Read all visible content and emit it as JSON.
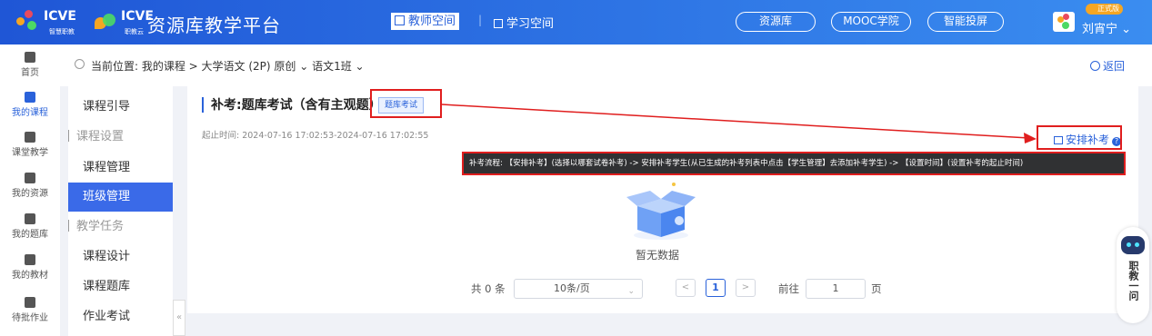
{
  "header": {
    "brand1": "ICVE",
    "brand1_sub": "智慧职教",
    "brand2": "ICVE",
    "brand2_sub": "职教云",
    "platform": "资源库教学平台",
    "space_teacher": "教师空间",
    "separator": "|",
    "space_learn": "学习空间",
    "pills": [
      "资源库",
      "MOOC学院",
      "智能投屏"
    ],
    "badge": "正式版",
    "user": "刘宵宁 ⌄"
  },
  "left_nav": [
    {
      "label": "首页",
      "icon": "home-icon"
    },
    {
      "label": "我的课程",
      "icon": "book-icon",
      "active": true
    },
    {
      "label": "课堂教学",
      "icon": "play-icon"
    },
    {
      "label": "我的资源",
      "icon": "library-icon"
    },
    {
      "label": "我的题库",
      "icon": "question-bank-icon"
    },
    {
      "label": "我的教材",
      "icon": "textbook-icon"
    },
    {
      "label": "待批作业",
      "icon": "homework-icon"
    }
  ],
  "breadcrumb": {
    "text": "当前位置: 我的课程 > 大学语文 (2P) 原创 ⌄  语文1班 ⌄",
    "back": "返回"
  },
  "side_menu": [
    {
      "label": "课程引导",
      "type": "item"
    },
    {
      "label": "课程设置",
      "type": "group"
    },
    {
      "label": "课程管理",
      "type": "item"
    },
    {
      "label": "班级管理",
      "type": "item",
      "active": true
    },
    {
      "label": "教学任务",
      "type": "group"
    },
    {
      "label": "课程设计",
      "type": "item"
    },
    {
      "label": "课程题库",
      "type": "item"
    },
    {
      "label": "作业考试",
      "type": "item"
    }
  ],
  "main": {
    "title": "补考:题库考试（含有主观题）",
    "tag": "题库考试",
    "time": "起止时间: 2024-07-16 17:02:53-2024-07-16 17:02:55",
    "arrange": "安排补考",
    "help": "?",
    "tooltip": "补考流程: 【安排补考】(选择以哪套试卷补考) -> 安排补考学生(从已生成的补考列表中点击【学生管理】去添加补考学生) -> 【设置时间】(设置补考的起止时间)",
    "empty": "暂无数据"
  },
  "pager": {
    "total": "共 0 条",
    "page_size": "10条/页",
    "page": "1",
    "goto_label": "前往",
    "goto_value": "1",
    "page_unit": "页"
  },
  "float": {
    "text": "职教一问"
  },
  "colors": {
    "primary": "#2a62da",
    "annotation_red": "#e01e1e",
    "active_menu": "#3a6ae8"
  }
}
